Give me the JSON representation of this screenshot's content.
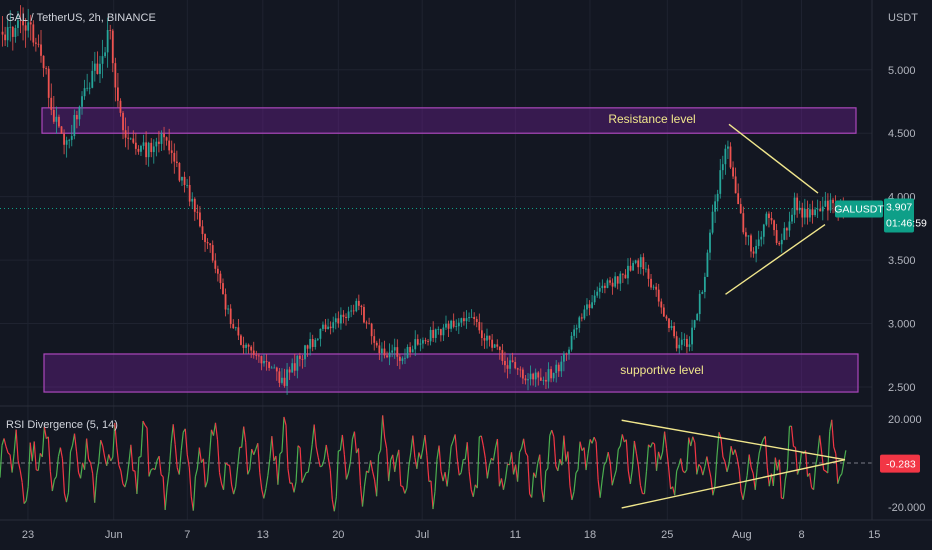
{
  "header": {
    "symbol_title": "GAL / TetherUS, 2h, BINANCE",
    "currency": "USDT"
  },
  "colors": {
    "background": "#131722",
    "grid": "#1f2330",
    "up": "#26a69a",
    "down": "#ef5350",
    "zone_fill": "#7b1fa2",
    "zone_border": "#ab47bc",
    "trendline": "#f0e68c",
    "price_tag": "#0e9f88",
    "rsi_tag": "#f23645",
    "rsi_up": "#4caf50",
    "rsi_down": "#f23645"
  },
  "chart_data": [
    {
      "type": "candlestick",
      "title": "GAL / TetherUS, 2h, BINANCE",
      "y_unit": "USDT",
      "ylim": [
        2.35,
        5.55
      ],
      "y_ticks": [
        2.5,
        3.0,
        3.5,
        4.0,
        4.5,
        5.0
      ],
      "y_tick_labels": [
        "2.500",
        "3.000",
        "3.500",
        "4.000",
        "4.500",
        "5.000"
      ],
      "x_tick_labels": [
        "23",
        "Jun",
        "7",
        "13",
        "20",
        "Jul",
        "11",
        "18",
        "25",
        "Aug",
        "8",
        "15"
      ],
      "x_tick_pos": [
        0.03,
        0.122,
        0.201,
        0.282,
        0.363,
        0.453,
        0.553,
        0.633,
        0.716,
        0.796,
        0.86,
        0.938
      ],
      "price_path": [
        [
          0.0,
          5.3
        ],
        [
          0.03,
          5.35
        ],
        [
          0.05,
          5.05
        ],
        [
          0.065,
          4.55
        ],
        [
          0.075,
          4.35
        ],
        [
          0.09,
          4.7
        ],
        [
          0.11,
          5.0
        ],
        [
          0.125,
          5.3
        ],
        [
          0.14,
          4.55
        ],
        [
          0.16,
          4.35
        ],
        [
          0.19,
          4.45
        ],
        [
          0.205,
          4.2
        ],
        [
          0.22,
          3.95
        ],
        [
          0.24,
          3.6
        ],
        [
          0.26,
          3.1
        ],
        [
          0.28,
          2.8
        ],
        [
          0.3,
          2.7
        ],
        [
          0.325,
          2.55
        ],
        [
          0.345,
          2.75
        ],
        [
          0.37,
          2.95
        ],
        [
          0.39,
          3.05
        ],
        [
          0.41,
          3.15
        ],
        [
          0.435,
          2.8
        ],
        [
          0.46,
          2.75
        ],
        [
          0.49,
          2.9
        ],
        [
          0.52,
          3.0
        ],
        [
          0.54,
          3.05
        ],
        [
          0.56,
          2.85
        ],
        [
          0.58,
          2.7
        ],
        [
          0.6,
          2.6
        ],
        [
          0.62,
          2.55
        ],
        [
          0.645,
          2.7
        ],
        [
          0.665,
          3.05
        ],
        [
          0.69,
          3.3
        ],
        [
          0.71,
          3.35
        ],
        [
          0.735,
          3.5
        ],
        [
          0.755,
          3.2
        ],
        [
          0.775,
          2.85
        ],
        [
          0.79,
          2.85
        ],
        [
          0.808,
          3.35
        ],
        [
          0.82,
          4.0
        ],
        [
          0.835,
          4.4
        ],
        [
          0.85,
          3.8
        ],
        [
          0.865,
          3.55
        ],
        [
          0.88,
          3.85
        ],
        [
          0.895,
          3.6
        ],
        [
          0.91,
          3.95
        ],
        [
          0.925,
          3.85
        ],
        [
          0.94,
          3.9
        ],
        [
          0.955,
          3.93
        ],
        [
          0.97,
          3.907
        ],
        [
          1.0,
          3.907
        ]
      ],
      "price_last_point_x": 0.97,
      "zones": [
        {
          "name": "resistance",
          "label": "Resistance level",
          "y_low": 4.5,
          "y_high": 4.7,
          "x_start": 0.0,
          "x_end": 1.0
        },
        {
          "name": "support",
          "label": "supportive level",
          "y_low": 2.46,
          "y_high": 2.76,
          "x_start": 0.0,
          "x_end": 1.0
        }
      ],
      "trendlines": [
        {
          "x1": 0.836,
          "y1": 4.57,
          "x2": 1.0,
          "y2": 3.7
        },
        {
          "x1": 0.832,
          "y1": 3.23,
          "x2": 1.0,
          "y2": 4.04
        }
      ],
      "last_price": 3.907,
      "last_price_label": "3.907",
      "countdown": "01:46:59",
      "symbol_tag": "GALUSDT"
    },
    {
      "type": "line",
      "title": "RSI Divergence (5, 14)",
      "ylim": [
        -26,
        26
      ],
      "y_ticks": [
        20,
        -20
      ],
      "y_tick_labels": [
        "20.000",
        "-20.000"
      ],
      "zero_line": 0,
      "last_value": -0.283,
      "last_value_label": "-0.283",
      "trendlines": [
        {
          "x1": 0.862,
          "y1": 19.5,
          "x2": 1.0,
          "y2": 1.5
        },
        {
          "x1": 0.862,
          "y1": -20.5,
          "x2": 1.0,
          "y2": 1.5
        }
      ]
    }
  ]
}
